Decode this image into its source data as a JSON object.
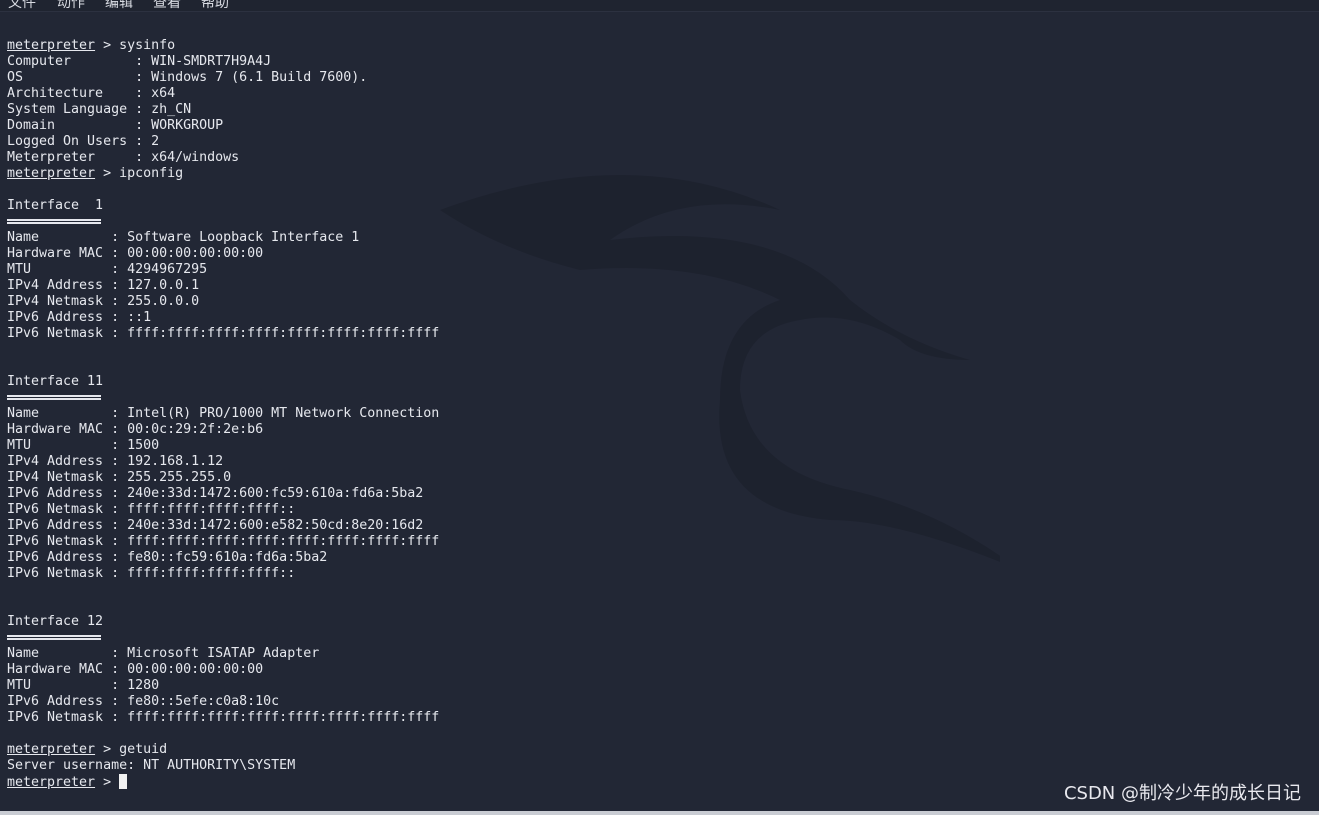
{
  "menu": [
    "文件",
    "动作",
    "编辑",
    "查看",
    "帮助"
  ],
  "prompt": "meterpreter",
  "lines": [
    {
      "type": "cmd",
      "text": " > sysinfo"
    },
    {
      "type": "out",
      "text": "Computer        : WIN-SMDRT7H9A4J"
    },
    {
      "type": "out",
      "text": "OS              : Windows 7 (6.1 Build 7600)."
    },
    {
      "type": "out",
      "text": "Architecture    : x64"
    },
    {
      "type": "out",
      "text": "System Language : zh_CN"
    },
    {
      "type": "out",
      "text": "Domain          : WORKGROUP"
    },
    {
      "type": "out",
      "text": "Logged On Users : 2"
    },
    {
      "type": "out",
      "text": "Meterpreter     : x64/windows"
    },
    {
      "type": "cmd",
      "text": " > ipconfig"
    },
    {
      "type": "out",
      "text": ""
    },
    {
      "type": "out",
      "text": "Interface  1"
    },
    {
      "type": "sep",
      "text": ""
    },
    {
      "type": "out",
      "text": "Name         : Software Loopback Interface 1"
    },
    {
      "type": "out",
      "text": "Hardware MAC : 00:00:00:00:00:00"
    },
    {
      "type": "out",
      "text": "MTU          : 4294967295"
    },
    {
      "type": "out",
      "text": "IPv4 Address : 127.0.0.1"
    },
    {
      "type": "out",
      "text": "IPv4 Netmask : 255.0.0.0"
    },
    {
      "type": "out",
      "text": "IPv6 Address : ::1"
    },
    {
      "type": "out",
      "text": "IPv6 Netmask : ffff:ffff:ffff:ffff:ffff:ffff:ffff:ffff"
    },
    {
      "type": "out",
      "text": ""
    },
    {
      "type": "out",
      "text": ""
    },
    {
      "type": "out",
      "text": "Interface 11"
    },
    {
      "type": "sep",
      "text": ""
    },
    {
      "type": "out",
      "text": "Name         : Intel(R) PRO/1000 MT Network Connection"
    },
    {
      "type": "out",
      "text": "Hardware MAC : 00:0c:29:2f:2e:b6"
    },
    {
      "type": "out",
      "text": "MTU          : 1500"
    },
    {
      "type": "out",
      "text": "IPv4 Address : 192.168.1.12"
    },
    {
      "type": "out",
      "text": "IPv4 Netmask : 255.255.255.0"
    },
    {
      "type": "out",
      "text": "IPv6 Address : 240e:33d:1472:600:fc59:610a:fd6a:5ba2"
    },
    {
      "type": "out",
      "text": "IPv6 Netmask : ffff:ffff:ffff:ffff::"
    },
    {
      "type": "out",
      "text": "IPv6 Address : 240e:33d:1472:600:e582:50cd:8e20:16d2"
    },
    {
      "type": "out",
      "text": "IPv6 Netmask : ffff:ffff:ffff:ffff:ffff:ffff:ffff:ffff"
    },
    {
      "type": "out",
      "text": "IPv6 Address : fe80::fc59:610a:fd6a:5ba2"
    },
    {
      "type": "out",
      "text": "IPv6 Netmask : ffff:ffff:ffff:ffff::"
    },
    {
      "type": "out",
      "text": ""
    },
    {
      "type": "out",
      "text": ""
    },
    {
      "type": "out",
      "text": "Interface 12"
    },
    {
      "type": "sep",
      "text": ""
    },
    {
      "type": "out",
      "text": "Name         : Microsoft ISATAP Adapter"
    },
    {
      "type": "out",
      "text": "Hardware MAC : 00:00:00:00:00:00"
    },
    {
      "type": "out",
      "text": "MTU          : 1280"
    },
    {
      "type": "out",
      "text": "IPv6 Address : fe80::5efe:c0a8:10c"
    },
    {
      "type": "out",
      "text": "IPv6 Netmask : ffff:ffff:ffff:ffff:ffff:ffff:ffff:ffff"
    },
    {
      "type": "out",
      "text": ""
    },
    {
      "type": "cmd",
      "text": " > getuid"
    },
    {
      "type": "out",
      "text": "Server username: NT AUTHORITY\\SYSTEM"
    },
    {
      "type": "input",
      "text": " > "
    }
  ],
  "watermark": "CSDN @制冷少年的成长日记"
}
